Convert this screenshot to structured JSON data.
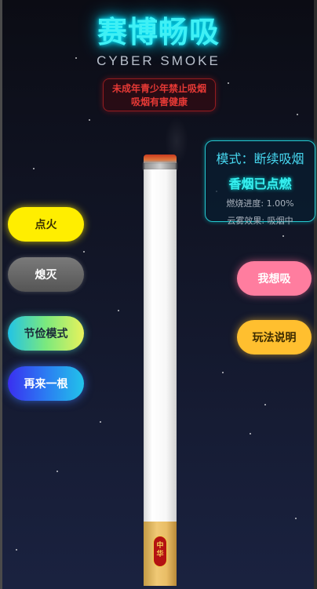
{
  "app": {
    "title": "赛博畅吸",
    "subtitle": "CYBER SMOKE",
    "warning_lines": [
      "未成年青少年禁止吸烟",
      "吸烟有害健康"
    ]
  },
  "status": {
    "mode_label": "模式：断续吸烟",
    "state": "香烟已点燃",
    "burn_progress": "燃烧进度: 1.00%",
    "smoke_effect": "云雾效果: 吸烟中"
  },
  "cigarette": {
    "burn_progress_percent": 1.0,
    "brand_badge_chars": [
      "中",
      "华"
    ]
  },
  "buttons": {
    "ignite": "点火",
    "extinguish": "熄灭",
    "saver_mode": "节俭模式",
    "another": "再来一根",
    "inhale": "我想吸",
    "guide": "玩法说明"
  },
  "colors": {
    "title_glow": "#3ff0f5",
    "warning_red": "#e53935",
    "panel_border": "#25c7cf",
    "ignite_yellow": "#ffee00",
    "inhale_pink": "#ff7d9f",
    "guide_orange": "#ffbf2f"
  }
}
